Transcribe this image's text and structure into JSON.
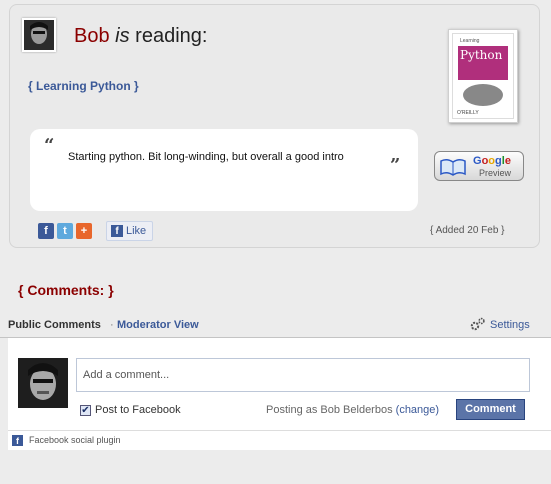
{
  "post": {
    "user": "Bob",
    "is": "is",
    "verb": "reading:",
    "book_link": "{ Learning Python }",
    "cover": {
      "small": "Learning",
      "title": "Python",
      "publisher": "O'REILLY"
    },
    "quote_open": "“",
    "quote_close": "”",
    "quote": "Starting python. Bit long-winding, but overall a good intro",
    "google_preview": {
      "google_letters": [
        "G",
        "o",
        "o",
        "g",
        "l",
        "e"
      ],
      "preview": "Preview"
    },
    "share": {
      "fb": "f",
      "twitter": "t",
      "plus": "+"
    },
    "like": {
      "f": "f",
      "label": "Like"
    },
    "added": "{ Added 20 Feb }"
  },
  "comments": {
    "heading": "{ Comments: }",
    "tab_public": "Public Comments",
    "tab_separator": "·",
    "tab_moderator": "Moderator View",
    "settings": "Settings",
    "input_placeholder": "Add a comment...",
    "post_to_facebook": "Post to Facebook",
    "posting_as": "Posting as Bob Belderbos",
    "change": "(change)",
    "button": "Comment",
    "plugin_f": "f",
    "plugin_label": "Facebook social plugin"
  },
  "colors": {
    "accent": "#8b0000",
    "link": "#3b5998",
    "button": "#5b74a8"
  }
}
